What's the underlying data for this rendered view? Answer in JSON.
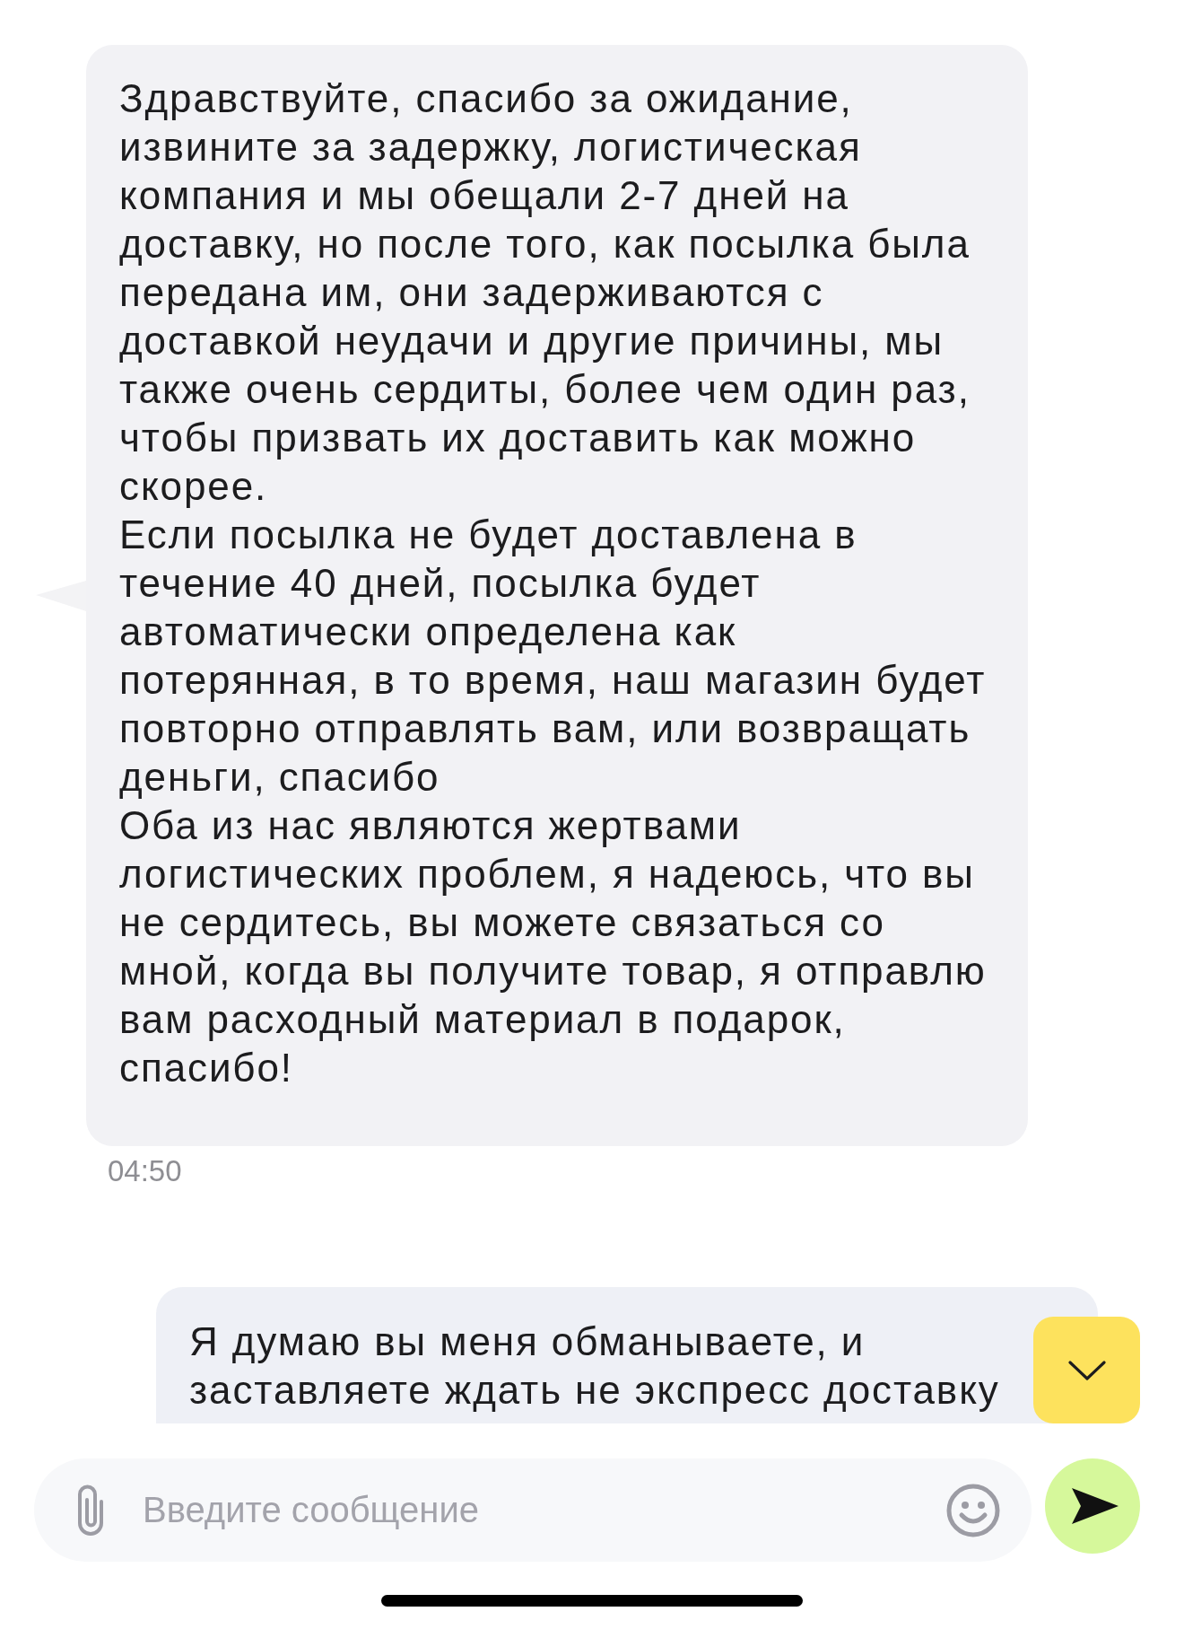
{
  "messages": [
    {
      "kind": "incoming",
      "paragraphs": [
        [
          "Здравствуйте, спасибо за ожидание,",
          "извините за задержку, логистическая",
          "компания и мы обещали 2-7 дней на",
          "доставку, но после того, как посылка была",
          "передана им, они задерживаются с",
          "доставкой неудачи и другие причины, мы",
          "также очень сердиты, более чем один раз,",
          "чтобы призвать их доставить как можно",
          "скорее."
        ],
        [
          "Если посылка не будет доставлена в",
          "течение 40 дней, посылка будет",
          "автоматически определена как",
          "потерянная, в то время, наш магазин будет",
          "повторно отправлять вам, или возвращать",
          "деньги, спасибо"
        ],
        [
          "Оба из нас являются жертвами",
          "логистических проблем, я надеюсь, что вы",
          "не сердитесь, вы можете связаться со",
          "мной, когда вы получите товар, я отправлю",
          "вам расходный материал в подарок,",
          "спасибо!"
        ]
      ],
      "time": "04:50"
    },
    {
      "kind": "outgoing",
      "paragraphs": [
        [
          "Я думаю вы меня обманываете, и",
          "заставляете ждать не экспресс доставку"
        ]
      ]
    }
  ],
  "composer": {
    "placeholder": "Введите сообщение"
  }
}
